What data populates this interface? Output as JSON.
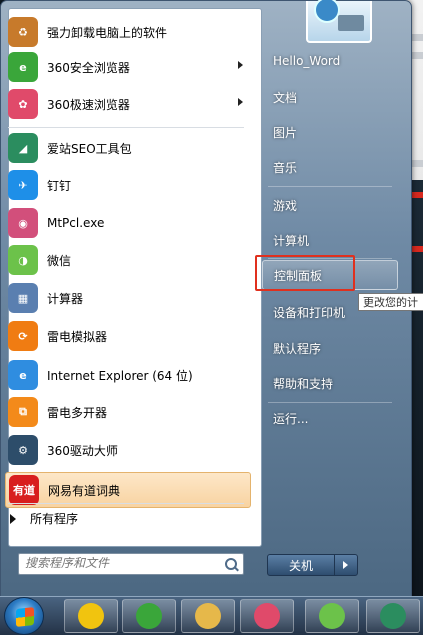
{
  "start_menu": {
    "pinned_apps": [
      {
        "label": "强力卸载电脑上的软件",
        "icon": "uninstall-icon",
        "color": "#c77a2b",
        "glyph": "♻",
        "has_submenu": false
      },
      {
        "label": "360安全浏览器",
        "icon": "360-browser-icon",
        "color": "#3aa63a",
        "glyph": "e",
        "has_submenu": true
      },
      {
        "label": "360极速浏览器",
        "icon": "360-speed-browser-icon",
        "color": "#e04a6a",
        "glyph": "✿",
        "has_submenu": true
      }
    ],
    "recent_apps": [
      {
        "label": "爱站SEO工具包",
        "icon": "aizhan-seo-icon",
        "color": "#2b8d5f",
        "glyph": "◢",
        "highlighted": false
      },
      {
        "label": "钉钉",
        "icon": "dingtalk-icon",
        "color": "#1e8fe8",
        "glyph": "✈",
        "highlighted": false
      },
      {
        "label": "MtPcl.exe",
        "icon": "mtpcl-camera-icon",
        "color": "#d24f7b",
        "glyph": "◉",
        "highlighted": false
      },
      {
        "label": "微信",
        "icon": "wechat-icon",
        "color": "#6cc24a",
        "glyph": "◑",
        "highlighted": false
      },
      {
        "label": "计算器",
        "icon": "calculator-icon",
        "color": "#5a7fb0",
        "glyph": "▦",
        "highlighted": false
      },
      {
        "label": "雷电模拟器",
        "icon": "leidian-emulator-icon",
        "color": "#f07c12",
        "glyph": "⟳",
        "highlighted": false
      },
      {
        "label": "Internet Explorer (64 位)",
        "icon": "internet-explorer-icon",
        "color": "#2f8de0",
        "glyph": "e",
        "highlighted": false
      },
      {
        "label": "雷电多开器",
        "icon": "leidian-multi-icon",
        "color": "#f38a1a",
        "glyph": "⧉",
        "highlighted": false
      },
      {
        "label": "360驱动大师",
        "icon": "360-driver-icon",
        "color": "#2d4d6a",
        "glyph": "⚙",
        "highlighted": false
      },
      {
        "label": "网易有道词典",
        "icon": "youdao-dictionary-icon",
        "color": "#d81e1e",
        "glyph": "有道",
        "highlighted": true
      }
    ],
    "all_programs_label": "所有程序",
    "search_placeholder": "搜索程序和文件",
    "right_items": [
      {
        "label": "Hello_Word",
        "name": "right-item-user"
      },
      {
        "label": "文档",
        "name": "right-item-documents"
      },
      {
        "label": "图片",
        "name": "right-item-pictures"
      },
      {
        "label": "音乐",
        "name": "right-item-music"
      },
      {
        "label": "游戏",
        "name": "right-item-games"
      },
      {
        "label": "计算机",
        "name": "right-item-computer"
      },
      {
        "label": "控制面板",
        "name": "right-item-control-panel"
      },
      {
        "label": "设备和打印机",
        "name": "right-item-devices-printers"
      },
      {
        "label": "默认程序",
        "name": "right-item-default-programs"
      },
      {
        "label": "帮助和支持",
        "name": "right-item-help-support"
      },
      {
        "label": "运行...",
        "name": "right-item-run"
      }
    ],
    "tooltip": "更改您的计",
    "shutdown_label": "关机"
  },
  "taskbar": {
    "buttons": [
      {
        "name": "taskbar-music-app",
        "icon": "music-note-icon",
        "color": "#f1c40f"
      },
      {
        "name": "taskbar-360-browser",
        "icon": "360-browser-icon",
        "color": "#3aa63a"
      },
      {
        "name": "taskbar-file-explorer",
        "icon": "folder-icon",
        "color": "#e6b84a"
      },
      {
        "name": "taskbar-360-speed-browser",
        "icon": "360-speed-browser-icon",
        "color": "#e04a6a"
      },
      {
        "name": "taskbar-wechat",
        "icon": "wechat-icon",
        "color": "#6cc24a"
      },
      {
        "name": "taskbar-aizhan-seo",
        "icon": "aizhan-seo-icon",
        "color": "#2b8d5f"
      }
    ]
  }
}
